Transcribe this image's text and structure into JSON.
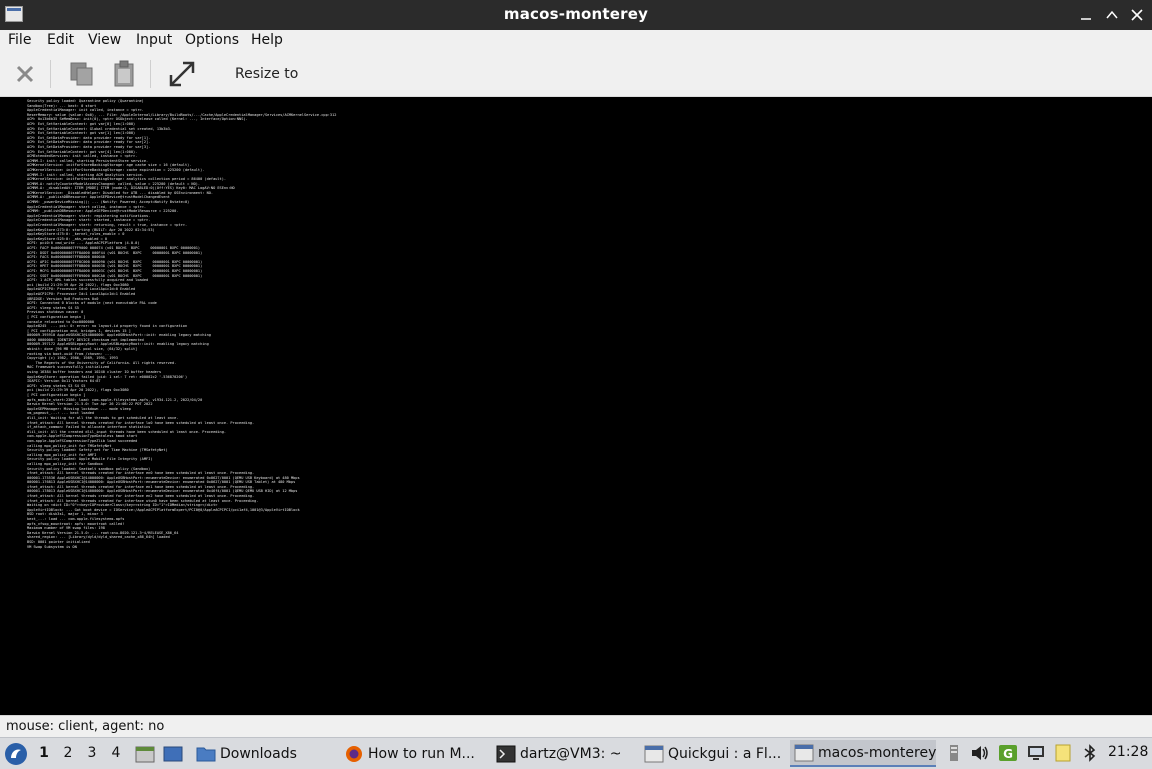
{
  "window": {
    "title": "macos-monterey",
    "controls": [
      "minimize",
      "maximize",
      "close"
    ]
  },
  "menu": [
    "File",
    "Edit",
    "View",
    "Input",
    "Options",
    "Help"
  ],
  "toolbar": {
    "resize_label": "Resize to",
    "buttons": [
      "close-icon",
      "copy-icon",
      "paste-icon",
      "fullscreen-icon"
    ]
  },
  "console_lines": [
    "Security policy loaded: Quarantine policy (Quarantine)",
    "Sandbox(Tree): ... kext: 0 start",
    "AppleCredentialManager: init called, instance = <ptr>.",
    "ReserMemory: value (value: 0x0), ... File: /AppleInternal/Library/BuildRoots/.../Cache/AppleCredentialManager/Services/ACMKernelService.cpp:312",
    "ACM: 0x13b6b35 SeMemDesc: init(0), <ptr> OSObject::release called (Kernel: ..., Interface/Option:NNS).",
    "ACM: Ext_SetVariableContent: got var[0] len(1:000)",
    "ACM: Ext_SetVariableContent: Global credential set created, 13b3b3.",
    "ACM: Ext_SetVariableContent: got var[1] len(1:000)",
    "ACM: Ext_SetDataProvider: data provider ready for var[1].",
    "ACM: Ext_SetDataProvider: data provider ready for var[2].",
    "ACM: Ext_SetDataProvider: data provider ready for var[3].",
    "ACM: Ext_SetVariableContent: got var[4] len(1:000).",
    "ACMExtendedServices: init called, instance = <ptr>.",
    "ACMRM-I: init: called, starting PersistentStore service.",
    "ACMKernelService: initForStoreBackingStorage: age cache size = 16 (default).",
    "ACMKernelService: initForStoreBackingStorage: cache expiration = 225200 (default).",
    "ACMRM-I: init: called, starting ACM Analytics service.",
    "ACMKernelService: initForStoreBackingStorage: analytics collection period = 86400 (default).",
    "ACMRM-A: notifyCounterModelAccessChanged: called, value = 225200 (default = NO).",
    "ACMRM-A: _disabledAt: ITEM [MODE] ITEM (mode:2, DISABLED:0)(Off:YES) Key0: MAC LogAV:NO ESEnv:NO",
    "ACMKernelService: _DisabledHelper: Disabled for ATB ... disabled by OSEnvironment: NO.",
    "ACMRM-A: _publishDBResource: AppleSEPDevice@trustModelChangedEvent",
    "ACMRM: _powerDeviceMissing(); ... (Notify: Powered; Accept=Notify Bstate=0)",
    "AppleCredentialManager: start called, instance = <ptr>.",
    "ACMRM: _publishDBResource: AppleSEPDevice@trustModelResource = 225200.",
    "AppleCredentialManager: start: registering notifications.",
    "AppleCredentialManager: start: started, instance = <ptr>.",
    "AppleCredentialManager: start: returning, result = true, instance = <ptr>.",
    "AppleKeyStore:273:0: starting (BUILT: Apr 20 2022 02:34:53)",
    "AppleKeyStore:475:0: _kernel_rules_enable = 0",
    "AppleKeyStore:525:0: _aks_enabled = 0",
    "ACPI: pci0:0 cmd_write ... AppleACPIPlatform (4.0.0)",
    "ACPI: FACP 0x000000007FF9000 000074 (v01 BOCHS  BXPC     00000001 BXPC 00000001)",
    "ACPI: DSDT 0x000000007FF8A000 000F44 (v01 BOCHS  BXPC     00000001 BXPC 00000001)",
    "ACPI: FACS 0x000000007FF8D000 000040",
    "ACPI: APIC 0x000000007FF8C000 000090 (v01 BOCHS  BXPC     00000001 BXPC 00000001)",
    "ACPI: HPET 0x000000007FF8B000 000038 (v01 BOCHS  BXPC     00000001 BXPC 00000001)",
    "ACPI: MCFG 0x000000007FF8A000 00003C (v01 BOCHS  BXPC     00000001 BXPC 00000001)",
    "ACPI: SSDT 0x000000007FF89000 000CA0 (v01 BOCHS  BXPC     00000001 BXPC 00000001)",
    "ACPI: 1 ACPI AML tables successfully acquired and loaded",
    "pci (build 21:29:39 Apr 20 2022), flags 0xc3080",
    "AppleACPICPU: Processor Id=0 LocalApicId=0 Enabled",
    "AppleACPICPU: Processor Id=1 LocalApicId=1 Enabled",
    "XBRIDGE: Version 0x0 Features 0x0",
    "ACPI: Connected 0 blocks of module (next executable PAL code",
    "ACPI: sleep states S4 S5",
    "Previous shutdown cause: 0",
    "[ PCI configuration begin ]",
    "console relocated to 0xc0000000",
    "Apple8245  ... pci: 0: error: no layout-id property found in configuration",
    "[ PCI configuration end, bridges 1, devices 15 ]",
    "000009.395910 AppleUSBXHCI@14000000: AppleUSBHostPort::init: enabling legacy matching",
    "0000 0000000: IDENTIFY DEVICE checksum not implemented",
    "000009.397172 AppleUSBLegacyRoot: AppleUSBLegacyRoot::init: enabling legacy matching",
    "mbinit: done [96 MB total pool size, (64/32) split]",
    "rooting via boot-uuid from /chosen: ...",
    "Copyright (c) 1982, 1986, 1989, 1991, 1993",
    "    The Regents of the University of California. All rights reserved.",
    "",
    "MAC Framework successfully initialized",
    "using 16384 buffer headers and 10240 cluster IO buffer headers",
    "AppleKeyStore: operation failed (pid: 1 sel: 7 ret: e00002c2 '-536870206')",
    "IOAPIC: Version 0x11 Vectors 64:87",
    "ACPI: sleep states S3 S4 S5",
    "pci (build 21:29:39 Apr 20 2022), flags 0xc3080",
    "[ PCI configuration begin ]",
    "apfs_module_start:2386: load: com.apple.filesystems.apfs, v1934.121.2, 2022/04/20",
    "Darwin Kernel Version 21.5.0: Tue Apr 26 21:08:22 PDT 2022",
    "AppleSEPManager: Missing lockdown ... mode sleep",
    "vm_pageout_...: ... kext loaded",
    "dlil_init: Waiting for all the threads to get scheduled at least once.",
    "ifnet_attach: All kernel threads created for interface lo0 have been scheduled at least once. Proceeding.",
    "if_attach_common: Failed to allocate interface statistics",
    "dlil_init: All the created dlil_input threads have been scheduled at least once. Proceeding.",
    "com.apple.AppleFSCompressionTypeDataless kmod start",
    "com.apple.AppleFSCompressionTypeZlib load succeeded",
    "calling mpo_policy_init for TMSafetyNet",
    "Security policy loaded: Safety net for Time Machine (TMSafetyNet)",
    "calling mpo_policy_init for AMFI",
    "Security policy loaded: Apple Mobile File Integrity (AMFI)",
    "calling mpo_policy_init for Sandbox",
    "Security policy loaded: Seatbelt sandbox policy (Sandbox)",
    "ifnet_attach: All kernel threads created for interface en0 have been scheduled at least once. Proceeding.",
    "000001.175536 AppleUSBXHCI@14000000: AppleUSBHostPort::enumerateDevice: enumerated 0x0627/0001 (QEMU USB Keyboard) at 480 Mbps",
    "000001.176813 AppleUSBXHCI@14000000: AppleUSBHostPort::enumerateDevice: enumerated 0x0627/0001 (QEMU USB Tablet) at 480 Mbps",
    "ifnet_attach: All kernel threads created for interface en1 have been scheduled at least once. Proceeding.",
    "000001.178013 AppleUSBXHCI@14000000: AppleUSBHostPort::enumerateDevice: enumerated 0x46f4/0001 (QEMU QEMU USB HID) at 12 Mbps",
    "ifnet_attach: All kernel threads created for interface en2 have been scheduled at least once. Proceeding.",
    "ifnet_attach: All kernel threads created for interface utun0 have been scheduled at least once. Proceeding.",
    "Waiting on <dict ID=\"0\"><key>IOProviderClass</key><string ID=\"1\">IOMedia</string></dict>",
    "AppleVirtIOBlock: ... Got boot device = IOService:/AppleACPIPlatformExpert/PCI0@0/AppleACPIPCI/pci1af4,1001@3/AppleVirtIOBlock",
    "BSD root: disk3s1, major 1, minor 3",
    "kext_...: load ... com.apple.filesystems.apfs",
    "apfs_vfsop_mountroot: apfs: mountroot called!",
    "Maximum number of VM swap files: 198",
    "Darwin Kernel Version 21.5.0: ... root:xnu-8020.121.3~4/RELEASE_X86_64",
    "shared_region: ... [Library/dyld/dyld_shared_cache_x86_64h] loaded",
    "BSD: 0001 pointer initialized",
    "VM Swap Subsystem is ON"
  ],
  "status": {
    "text": "mouse: client, agent:  no"
  },
  "taskbar": {
    "workspaces": [
      "1",
      "2",
      "3",
      "4"
    ],
    "active_workspace": "1",
    "tasks": [
      {
        "label": "Downloads",
        "icon": "folder-icon"
      },
      {
        "label": "How to run M...",
        "icon": "firefox-icon"
      },
      {
        "label": "dartz@VM3: ~",
        "icon": "terminal-icon"
      },
      {
        "label": "Quickgui : a Fl...",
        "icon": "window-icon"
      },
      {
        "label": "macos-monterey",
        "icon": "window-icon"
      }
    ],
    "active_task": "macos-monterey",
    "clock": "21:28"
  }
}
